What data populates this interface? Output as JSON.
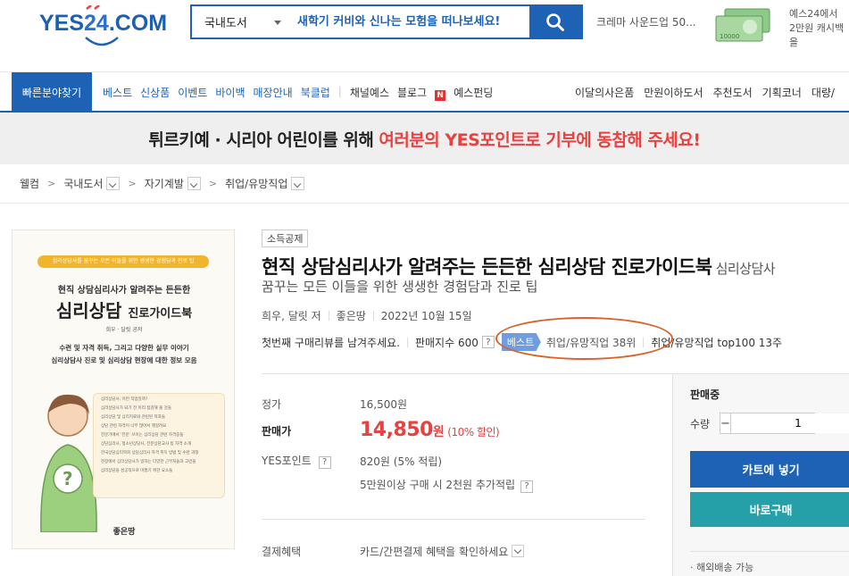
{
  "header": {
    "logo_text": "YES24.COM",
    "search": {
      "category": "국내도서",
      "placeholder": "새학기 커비와 신나는 모험을 떠나보세요!"
    },
    "promo_text": "크레마 사운드업 50...",
    "ad_line1": "예스24에서",
    "ad_line2": "2만원 캐시백을"
  },
  "nav": {
    "quick": "빠른분야찾기",
    "items": [
      "베스트",
      "신상품",
      "이벤트",
      "바이백",
      "매장안내",
      "북클럽"
    ],
    "items_dark": [
      "채널예스",
      "블로그"
    ],
    "funding": "예스펀딩",
    "right": [
      "이달의사은품",
      "만원이하도서",
      "추천도서",
      "기획코너",
      "대량/"
    ]
  },
  "banner": {
    "text": "튀르키예 · 시리아 어린이를 위해",
    "highlight": "여러분의 YES포인트로 기부에 동참해 주세요!"
  },
  "breadcrumb": [
    "웰컴",
    "국내도서",
    "자기계발",
    "취업/유망직업"
  ],
  "cover": {
    "stripe": "심리상담사를 꿈꾸는 모든 이들을 위한 생생한 경험담과 진로 팁",
    "sub": "현직 상담심리사가 알려주는 든든한",
    "title_big": "심리상담",
    "title_small": "진로가이드북",
    "authors": "희우 · 달릿 공저",
    "desc1": "수련 및 자격 취득, 그리고 다양한 실무 이야기",
    "desc2": "심리상담사 진로 및 심리상담 현장에 대한 정보 모음",
    "card_lines": [
      "심리상담사, 어떤 직업일까?",
      "심리상담사가 되기 전 미리 점검해 볼 것들",
      "심리상담 및 심리치료와 관련된 학과들",
      "상담 관련 자격이 너무 많아서 헷갈려요",
      "전문가에서 '전문' 쓰이는 심리상담 관련 자격증들",
      "상담심리사, 청소년상담사, 전문상담교사 등 자격 소개",
      "한국상담심리학회 상담심리사 자격 취득 방법 및 수련 과정",
      "현장에서 심리상담사가 일하는 다양한 근무처들과 고민들",
      "심리상담을 성공적으로 마쳤기 위한 요소들"
    ],
    "publisher": "좋은땅"
  },
  "product": {
    "tag": "소득공제",
    "title": "현직 상담심리사가 알려주는 든든한 심리상담 진로가이드북",
    "title_rest": "심리상담사",
    "subtitle": "꿈꾸는 모든 이들을 위한 생생한 경험담과 진로 팁",
    "author": "희우, 달릿 저",
    "publisher": "좋은땅",
    "date": "2022년 10월 15일",
    "review": "첫번째 구매리뷰를 남겨주세요.",
    "sales_index": "판매지수 600",
    "best_badge": "베스트",
    "rank1": "취업/유망직업 38위",
    "rank2": "취업/유망직업 top100 13주"
  },
  "price": {
    "list_label": "정가",
    "list_value": "16,500원",
    "sale_label": "판매가",
    "sale_value": "14,850",
    "sale_unit": "원",
    "sale_pct": "(10% 할인)",
    "point_label": "YES포인트",
    "point_value": "820원 (5% 적립)",
    "point_extra": "5만원이상 구매 시 2천원 추가적립",
    "pay_label": "결제혜택",
    "pay_value": "카드/간편결제 혜택을 확인하세요"
  },
  "buybox": {
    "status": "판매중",
    "qty_label": "수량",
    "qty_value": "1",
    "cart": "카트에 넣기",
    "buy": "바로구매",
    "note": "· 해외배송 가능"
  }
}
